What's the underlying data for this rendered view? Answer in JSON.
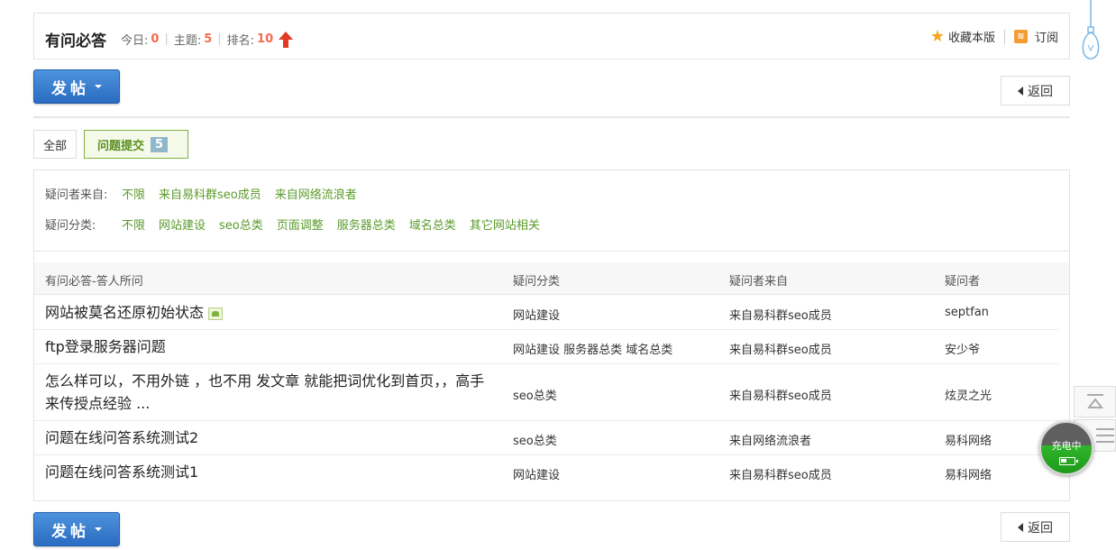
{
  "forum": {
    "title": "有问必答",
    "today_label": "今日:",
    "today_value": "0",
    "topics_label": "主题:",
    "topics_value": "5",
    "rank_label": "排名:",
    "rank_value": "10",
    "favorite_label": "收藏本版",
    "subscribe_label": "订阅"
  },
  "buttons": {
    "post_label": "发帖",
    "back_label": "返回"
  },
  "tabs": {
    "all_label": "全部",
    "qa_label": "问题提交",
    "qa_count": "5"
  },
  "filters": {
    "source_label": "疑问者来自:",
    "source_options": [
      "不限",
      "来自易科群seo成员",
      "来自网络流浪者"
    ],
    "category_label": "疑问分类:",
    "category_options": [
      "不限",
      "网站建设",
      "seo总类",
      "页面调整",
      "服务器总类",
      "域名总类",
      "其它网站相关"
    ]
  },
  "table": {
    "headers": [
      "有问必答-答人所问",
      "疑问分类",
      "疑问者来自",
      "疑问者"
    ],
    "rows": [
      {
        "subject": "网站被莫名还原初始状态",
        "category": "网站建设",
        "source": "来自易科群seo成员",
        "author": "septfan"
      },
      {
        "subject": "ftp登录服务器问题",
        "category": "网站建设 服务器总类 域名总类",
        "source": "来自易科群seo成员",
        "author": "安少爷"
      },
      {
        "subject": "怎么样可以，不用外链 ，也不用 发文章 就能把词优化到首页，，高手来传授点经验 ...",
        "category": "seo总类",
        "source": "来自易科群seo成员",
        "author": "炫灵之光"
      },
      {
        "subject": "问题在线问答系统测试2",
        "category": "seo总类",
        "source": "来自网络流浪者",
        "author": "易科网络"
      },
      {
        "subject": "问题在线问答系统测试1",
        "category": "网站建设",
        "source": "来自易科群seo成员",
        "author": "易科网络"
      }
    ]
  },
  "widget": {
    "charging_label": "充电中"
  },
  "colors": {
    "accent_green": "#5a9a2a",
    "stat_orange": "#f26c4f",
    "button_blue": "#2a6cc1"
  }
}
